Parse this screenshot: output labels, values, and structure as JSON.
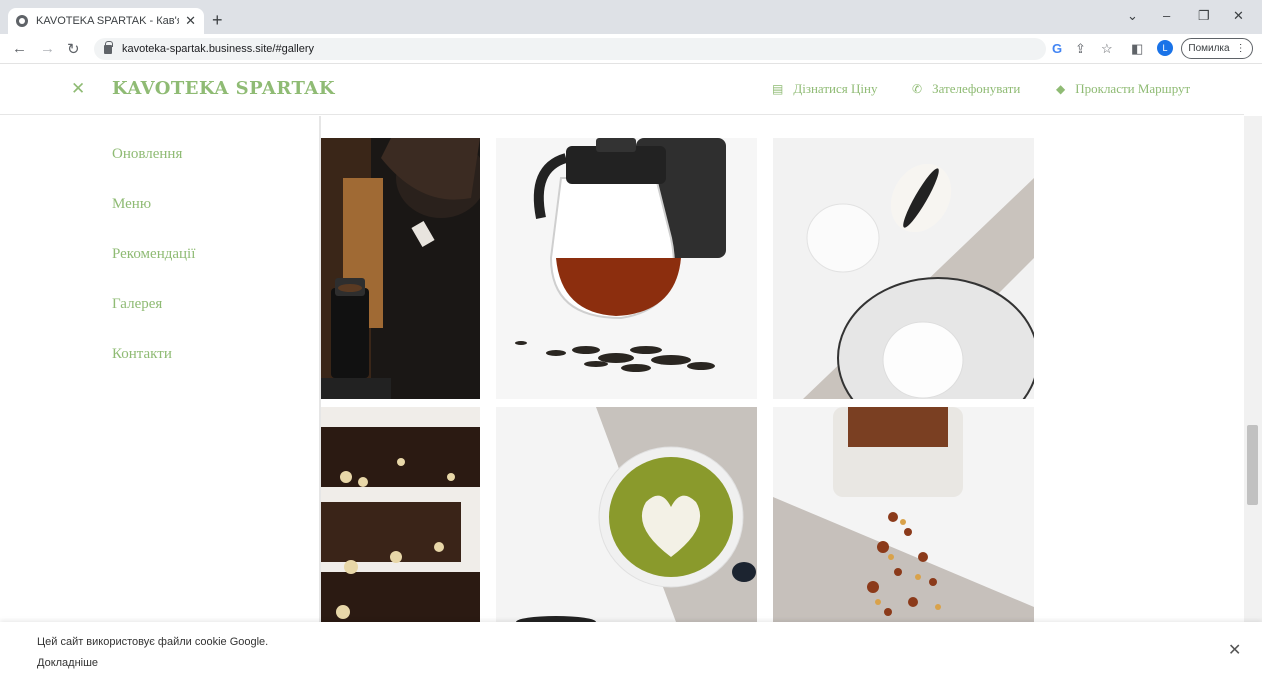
{
  "browser": {
    "tab_title": "KAVOTEKA SPARTAK - Кав'ярня у",
    "tab_close": "✕",
    "new_tab": "+",
    "url": "kavoteka-spartak.business.site/#gallery",
    "error_button": "Помилка",
    "profile_initial": "L",
    "window_controls": {
      "collapse": "⌄",
      "minimize": "–",
      "restore": "❐",
      "close": "✕"
    }
  },
  "header": {
    "close_icon": "✕",
    "logo": "KAVOTEKA SPARTAK",
    "actions": [
      {
        "label": "Дізнатися Ціну",
        "icon": "menu-list-icon"
      },
      {
        "label": "Зателефонувати",
        "icon": "phone-icon"
      },
      {
        "label": "Прокласти Маршрут",
        "icon": "directions-icon"
      }
    ]
  },
  "sidenav": {
    "items": [
      {
        "label": "Оновлення"
      },
      {
        "label": "Меню"
      },
      {
        "label": "Рекомендації"
      },
      {
        "label": "Галерея"
      },
      {
        "label": "Контакти"
      }
    ]
  },
  "gallery": {
    "images": [
      {
        "name": "barista-brewing-image"
      },
      {
        "name": "tea-teapot-image"
      },
      {
        "name": "macarons-plate-image"
      },
      {
        "name": "brownies-image"
      },
      {
        "name": "matcha-latte-image"
      },
      {
        "name": "dried-fruit-tea-image"
      }
    ]
  },
  "cookie_banner": {
    "text": "Цей сайт використовує файли cookie Google.",
    "link": "Докладніше",
    "close": "✕"
  },
  "colors": {
    "accent_green": "#8fbb74",
    "chrome_bg": "#dee1e6"
  }
}
